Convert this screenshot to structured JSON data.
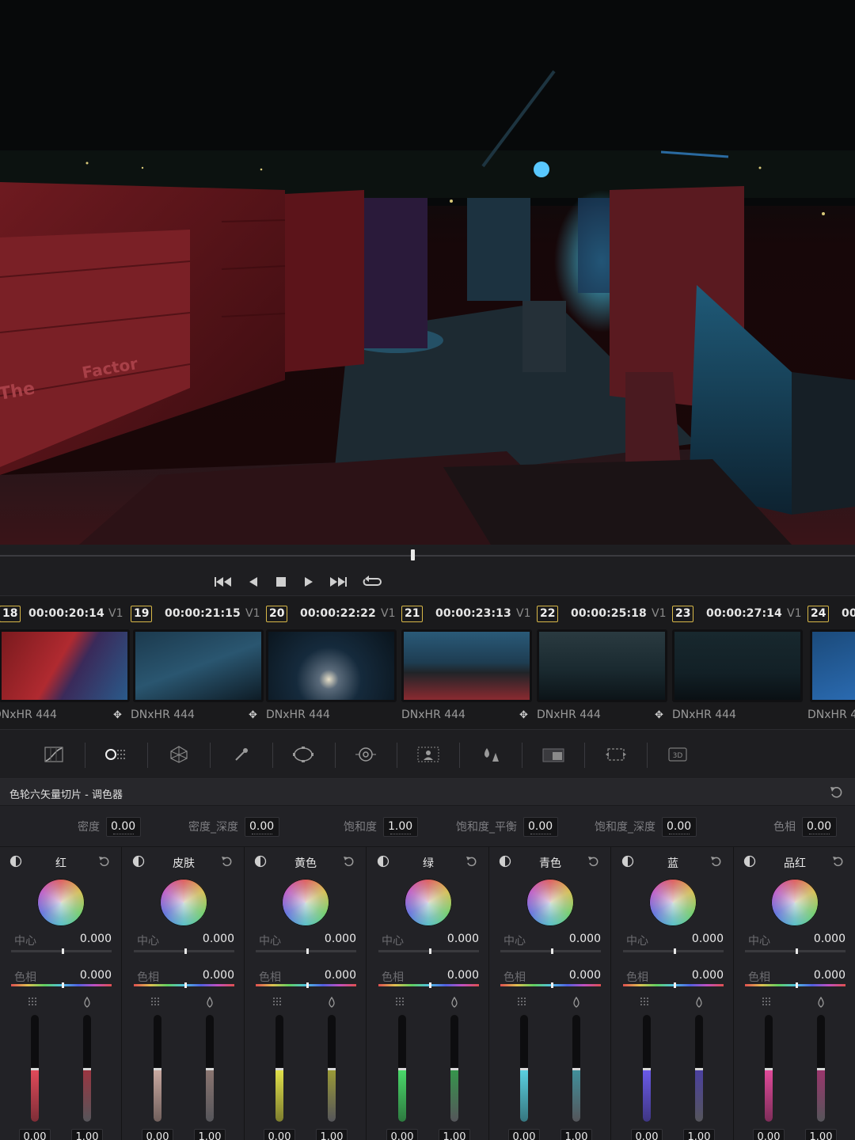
{
  "transport": {
    "buttons": [
      "skip-to-start",
      "step-back",
      "stop",
      "play",
      "skip-to-end",
      "loop"
    ]
  },
  "clips": [
    {
      "num": "18",
      "timecode": "00:00:20:14",
      "track": "V1",
      "codec": "DNxHR 444",
      "codec_icon": false,
      "tint": "#7a1a1e"
    },
    {
      "num": "19",
      "timecode": "00:00:21:15",
      "track": "V1",
      "codec": "DNxHR 444",
      "codec_icon": true,
      "tint": "#1c3a4e"
    },
    {
      "num": "20",
      "timecode": "00:00:22:22",
      "track": "V1",
      "codec": "DNxHR 444",
      "codec_icon": true,
      "tint": "#152a3c"
    },
    {
      "num": "21",
      "timecode": "00:00:23:13",
      "track": "V1",
      "codec": "DNxHR 444",
      "codec_icon": false,
      "tint": "#1e3d52"
    },
    {
      "num": "22",
      "timecode": "00:00:25:18",
      "track": "V1",
      "codec": "DNxHR 444",
      "codec_icon": true,
      "tint": "#1a2a30"
    },
    {
      "num": "23",
      "timecode": "00:00:27:14",
      "track": "V1",
      "codec": "DNxHR 444",
      "codec_icon": true,
      "tint": "#122026"
    },
    {
      "num": "24",
      "timecode": "00",
      "track": "",
      "codec": "DNxHR 4",
      "codec_icon": false,
      "tint": "#1b4a7a"
    }
  ],
  "palettes": [
    "curves",
    "color-warper",
    "hsl-qualifier",
    "eyedropper",
    "power-window",
    "tracker",
    "magic-mask",
    "blur",
    "key",
    "sizing",
    "3d"
  ],
  "panel": {
    "title": "色轮六矢量切片 - 调色器"
  },
  "globals": [
    {
      "label": "密度",
      "value": "0.00"
    },
    {
      "label": "密度_深度",
      "value": "0.00"
    },
    {
      "label": "饱和度",
      "value": "1.00"
    },
    {
      "label": "饱和度_平衡",
      "value": "0.00"
    },
    {
      "label": "饱和度_深度",
      "value": "0.00"
    },
    {
      "label": "色相",
      "value": "0.00"
    }
  ],
  "vectors": [
    {
      "name": "红",
      "center_label": "中心",
      "center_value": "0.000",
      "hue_label": "色相",
      "hue_value": "0.000",
      "slider_left": "0.00",
      "slider_right": "1.00",
      "color": "#e04a5a"
    },
    {
      "name": "皮肤",
      "center_label": "中心",
      "center_value": "0.000",
      "hue_label": "色相",
      "hue_value": "0.000",
      "slider_left": "0.00",
      "slider_right": "1.00",
      "color": "#c8a8a0"
    },
    {
      "name": "黄色",
      "center_label": "中心",
      "center_value": "0.000",
      "hue_label": "色相",
      "hue_value": "0.000",
      "slider_left": "0.00",
      "slider_right": "1.00",
      "color": "#e0e04a"
    },
    {
      "name": "绿",
      "center_label": "中心",
      "center_value": "0.000",
      "hue_label": "色相",
      "hue_value": "0.000",
      "slider_left": "0.00",
      "slider_right": "1.00",
      "color": "#4ad86a"
    },
    {
      "name": "青色",
      "center_label": "中心",
      "center_value": "0.000",
      "hue_label": "色相",
      "hue_value": "0.000",
      "slider_left": "0.00",
      "slider_right": "1.00",
      "color": "#5ad0e0"
    },
    {
      "name": "蓝",
      "center_label": "中心",
      "center_value": "0.000",
      "hue_label": "色相",
      "hue_value": "0.000",
      "slider_left": "0.00",
      "slider_right": "1.00",
      "color": "#6a5ae8"
    },
    {
      "name": "品红",
      "center_label": "中心",
      "center_value": "0.000",
      "hue_label": "色相",
      "hue_value": "0.000",
      "slider_left": "0.00",
      "slider_right": "1.00",
      "color": "#e04a9a"
    }
  ]
}
